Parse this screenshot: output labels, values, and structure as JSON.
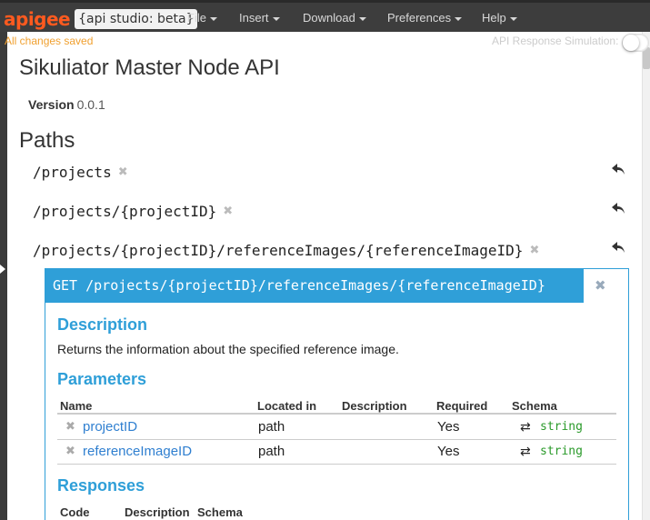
{
  "app": {
    "brand": "apigee",
    "studio_label": "{api studio: beta}"
  },
  "menu": [
    {
      "label": "File"
    },
    {
      "label": "Insert"
    },
    {
      "label": "Download"
    },
    {
      "label": "Preferences"
    },
    {
      "label": "Help"
    }
  ],
  "status": {
    "saved": "All changes saved",
    "simulation_label": "API Response Simulation:"
  },
  "spec": {
    "title": "Sikuliator Master Node API",
    "version_label": "Version",
    "version_value": "0.0.1",
    "paths_heading": "Paths",
    "paths": [
      "/projects",
      "/projects/{projectID}",
      "/projects/{projectID}/referenceImages/{referenceImageID}"
    ]
  },
  "operation": {
    "header": "GET /projects/{projectID}/referenceImages/{referenceImageID}",
    "description_heading": "Description",
    "description_text": "Returns the information about the specified reference image.",
    "parameters_heading": "Parameters",
    "param_columns": [
      "Name",
      "Located in",
      "Description",
      "Required",
      "Schema"
    ],
    "params": [
      {
        "name": "projectID",
        "located": "path",
        "required": "Yes",
        "schema": "string"
      },
      {
        "name": "referenceImageID",
        "located": "path",
        "required": "Yes",
        "schema": "string"
      }
    ],
    "responses_heading": "Responses",
    "response_columns": [
      "Code",
      "Description",
      "Schema"
    ]
  },
  "colors": {
    "accent": "#2f9fd8",
    "brand": "#ff5a1f",
    "saved": "#f0a030",
    "schema_type": "#2a9a2a"
  },
  "icons": {
    "remove": "✖",
    "swap": "⇄",
    "reply": "reply-arrow"
  }
}
